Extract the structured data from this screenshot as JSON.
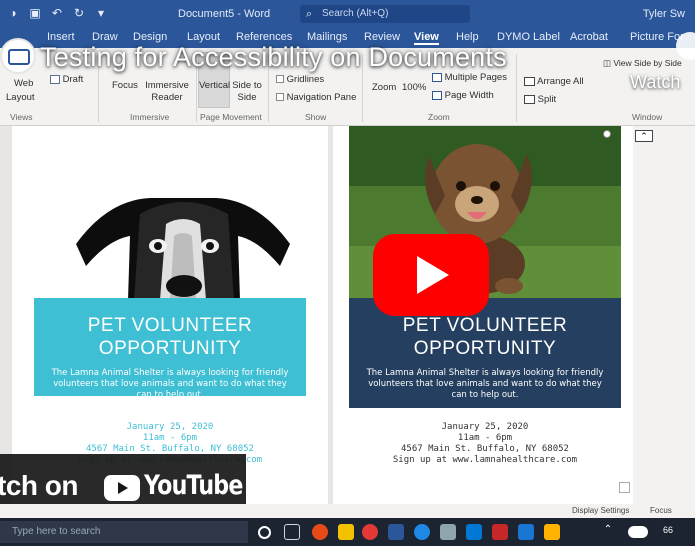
{
  "video": {
    "title": "Testing for Accessibility on Documents",
    "watch_later": "Watch",
    "watch_on_prefix": "tch on",
    "youtube_wordmark": "YouTube"
  },
  "titlebar": {
    "document_title": "Document5 - Word",
    "search_placeholder": "Search (Alt+Q)",
    "user": "Tyler Sw"
  },
  "ribbon_tabs": [
    "Insert",
    "Draw",
    "Design",
    "Layout",
    "References",
    "Mailings",
    "Review",
    "View",
    "Help",
    "DYMO Label",
    "Acrobat",
    "Picture For"
  ],
  "active_tab": "View",
  "ribbon": {
    "views": {
      "web": "Web",
      "layout": "Layout",
      "draft": "Draft",
      "group": "Views"
    },
    "immersive": {
      "focus": "Focus",
      "reader": "Immersive Reader",
      "group": "Immersive"
    },
    "page_movement": {
      "vertical": "Vertical",
      "side": "Side to Side",
      "group": "Page Movement"
    },
    "show": {
      "gridlines": "Gridlines",
      "nav": "Navigation Pane",
      "group": "Show"
    },
    "zoom": {
      "zoom": "Zoom",
      "pct": "100%",
      "multiple": "Multiple Pages",
      "width": "Page Width",
      "group": "Zoom"
    },
    "window": {
      "arrange": "Arrange All",
      "split": "Split",
      "side_by_side": "View Side by Side",
      "group": "Window"
    }
  },
  "page1": {
    "heading": "PET VOLUNTEER OPPORTUNITY",
    "body": "The Lamna Animal Shelter is always looking for friendly volunteers that love animals and want to do what they can to help out.",
    "date": "January 25, 2020",
    "time": "11am - 6pm",
    "address": "4567 Main St. Buffalo, NY 68052",
    "signup": "Sign up at www.lamnahealthcare.com",
    "banner_color": "#3fbfd3",
    "text_color": "#3fbfd3"
  },
  "page2": {
    "heading": "PET VOLUNTEER OPPORTUNITY",
    "body": "The Lamna Animal Shelter is always looking for friendly volunteers that love animals and want to do what they can to help out.",
    "date": "January 25, 2020",
    "time": "11am - 6pm",
    "address": "4567 Main St. Buffalo, NY 68052",
    "signup": "Sign up at www.lamnahealthcare.com",
    "banner_color": "#243f5f",
    "text_color": "#333333"
  },
  "statusbar": {
    "display_settings": "Display Settings",
    "focus": "Focus"
  },
  "taskbar": {
    "search_placeholder": "Type here to search",
    "tray": "66"
  },
  "colors": {
    "word_blue": "#2b579a",
    "youtube_red": "#ff0000"
  }
}
